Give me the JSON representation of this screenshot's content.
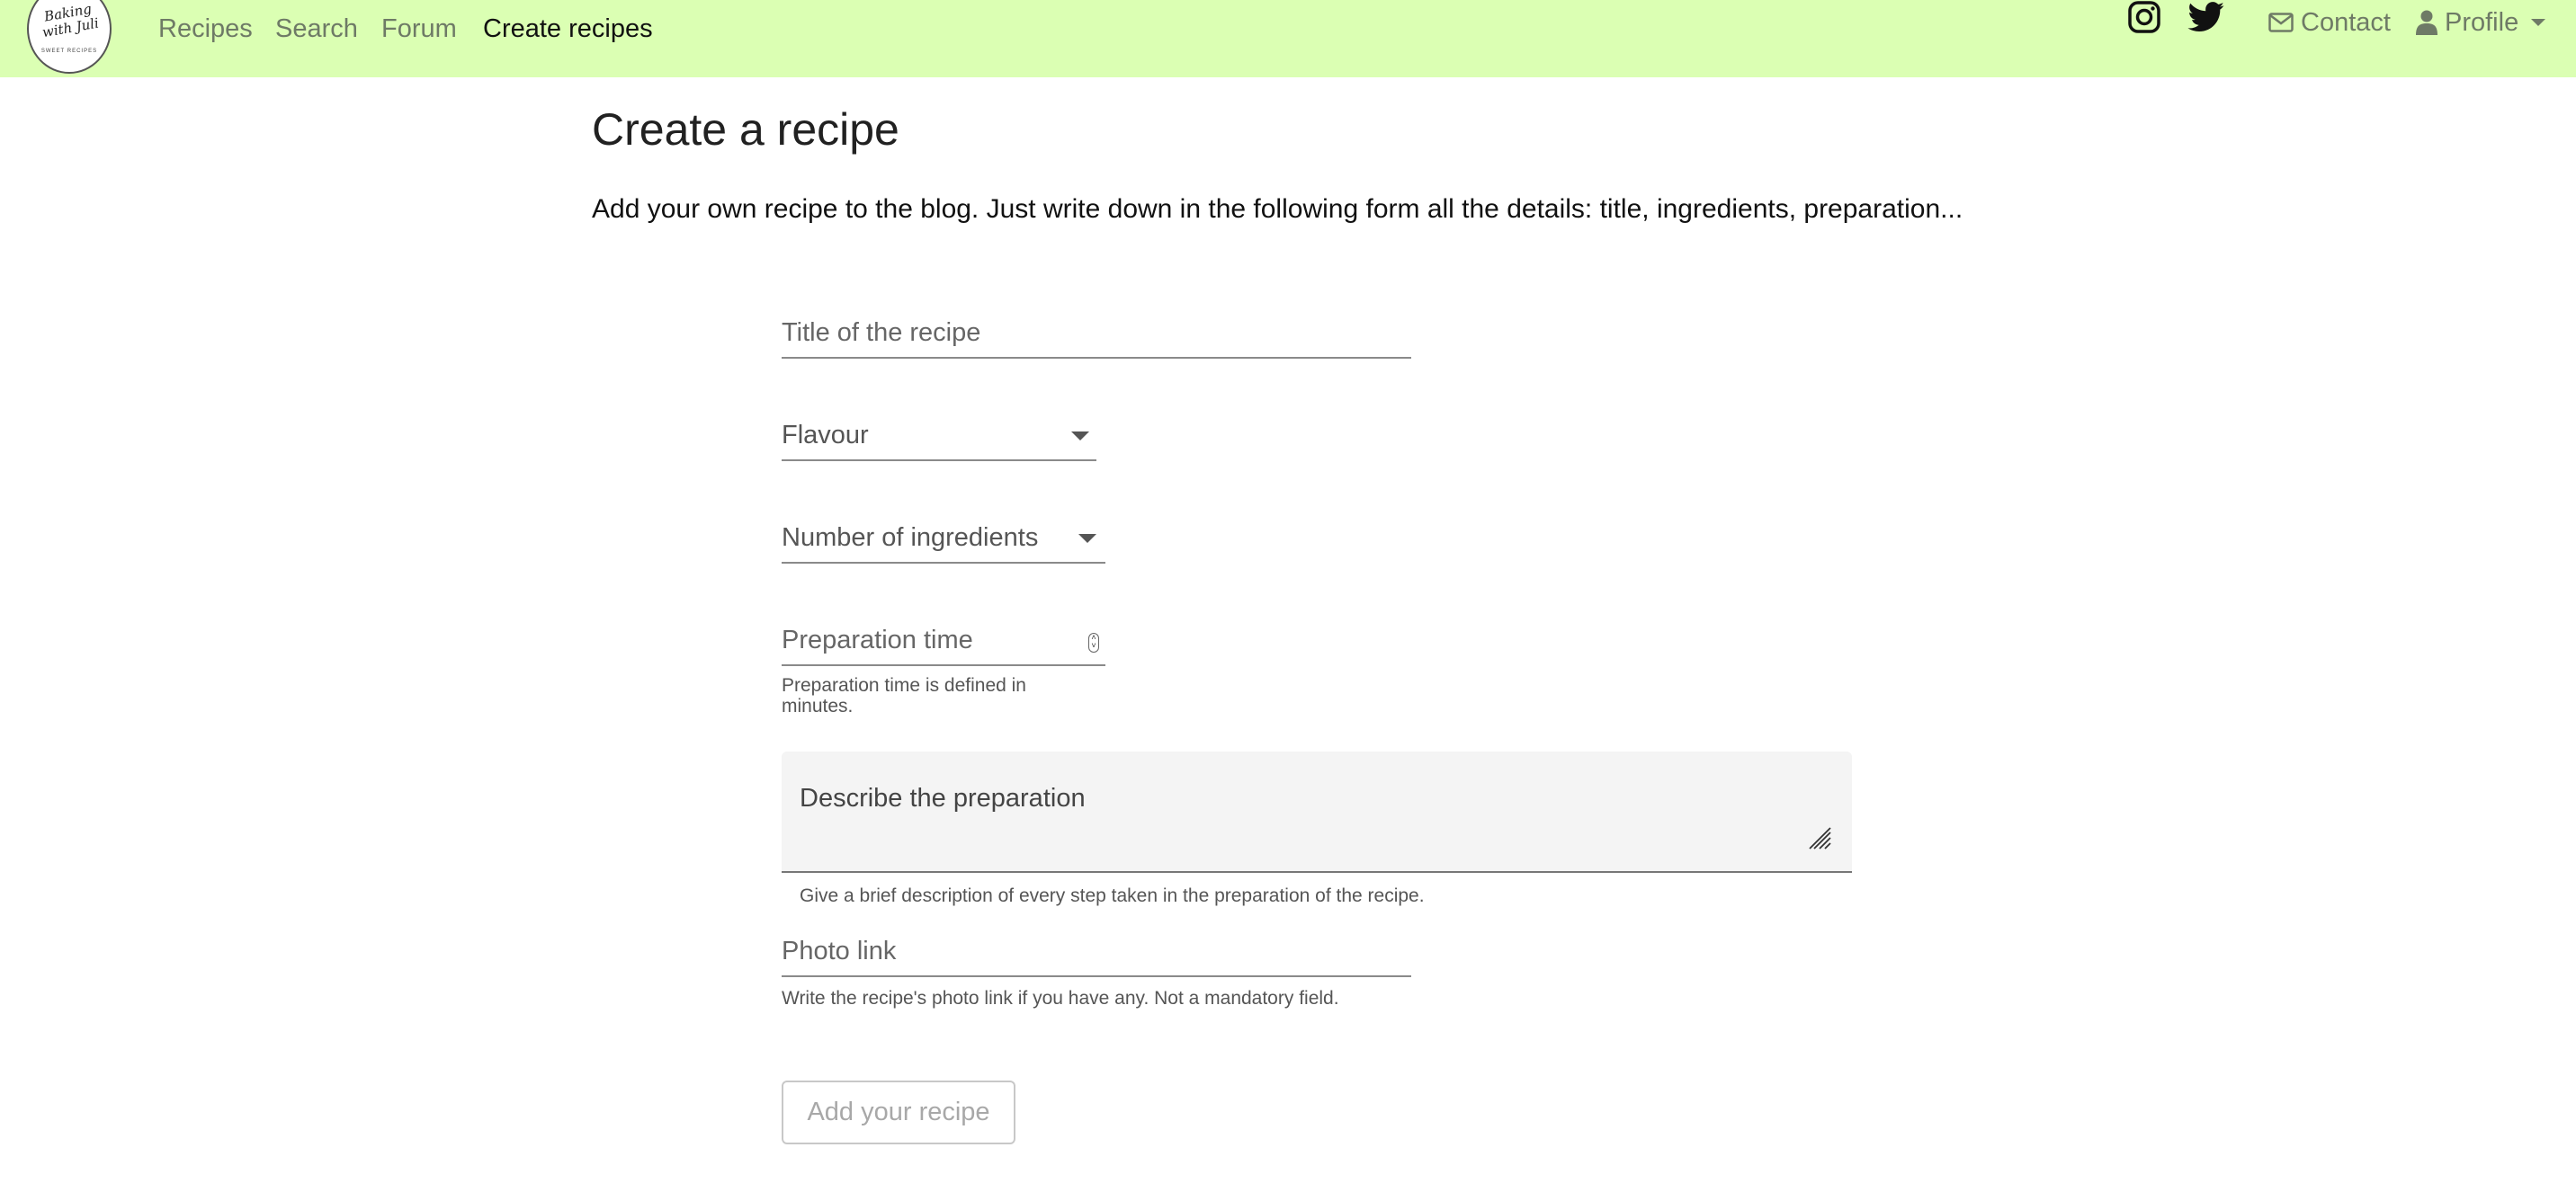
{
  "brand": {
    "logo_script": "Baking with Juli",
    "logo_tagline": "SWEET RECIPES"
  },
  "nav": {
    "links": [
      {
        "label": "Recipes"
      },
      {
        "label": "Search"
      },
      {
        "label": "Forum"
      },
      {
        "label": "Create recipes",
        "active": true
      }
    ],
    "social": [
      {
        "icon": "instagram-icon"
      },
      {
        "icon": "twitter-icon"
      }
    ],
    "contact_label": "Contact",
    "contact_icon": "envelope-icon",
    "profile_label": "Profile",
    "profile_icon": "user-icon"
  },
  "page": {
    "title": "Create a recipe",
    "intro": "Add your own recipe to the blog. Just write down in the following form all the details: title, ingredients, preparation..."
  },
  "form": {
    "title_placeholder": "Title of the recipe",
    "flavour_label": "Flavour",
    "ingredients_label": "Number of ingredients",
    "prep_time_placeholder": "Preparation time",
    "prep_time_helper": "Preparation time is defined in minutes.",
    "description_placeholder": "Describe the preparation",
    "description_helper": "Give a brief description of every step taken in the preparation of the recipe.",
    "photo_placeholder": "Photo link",
    "photo_helper": "Write the recipe's photo link if you have any. Not a mandatory field.",
    "submit_label": "Add your recipe"
  },
  "colors": {
    "navbar_bg": "#dbffb3",
    "nav_text": "#6e7a66",
    "nav_active": "#111111"
  }
}
